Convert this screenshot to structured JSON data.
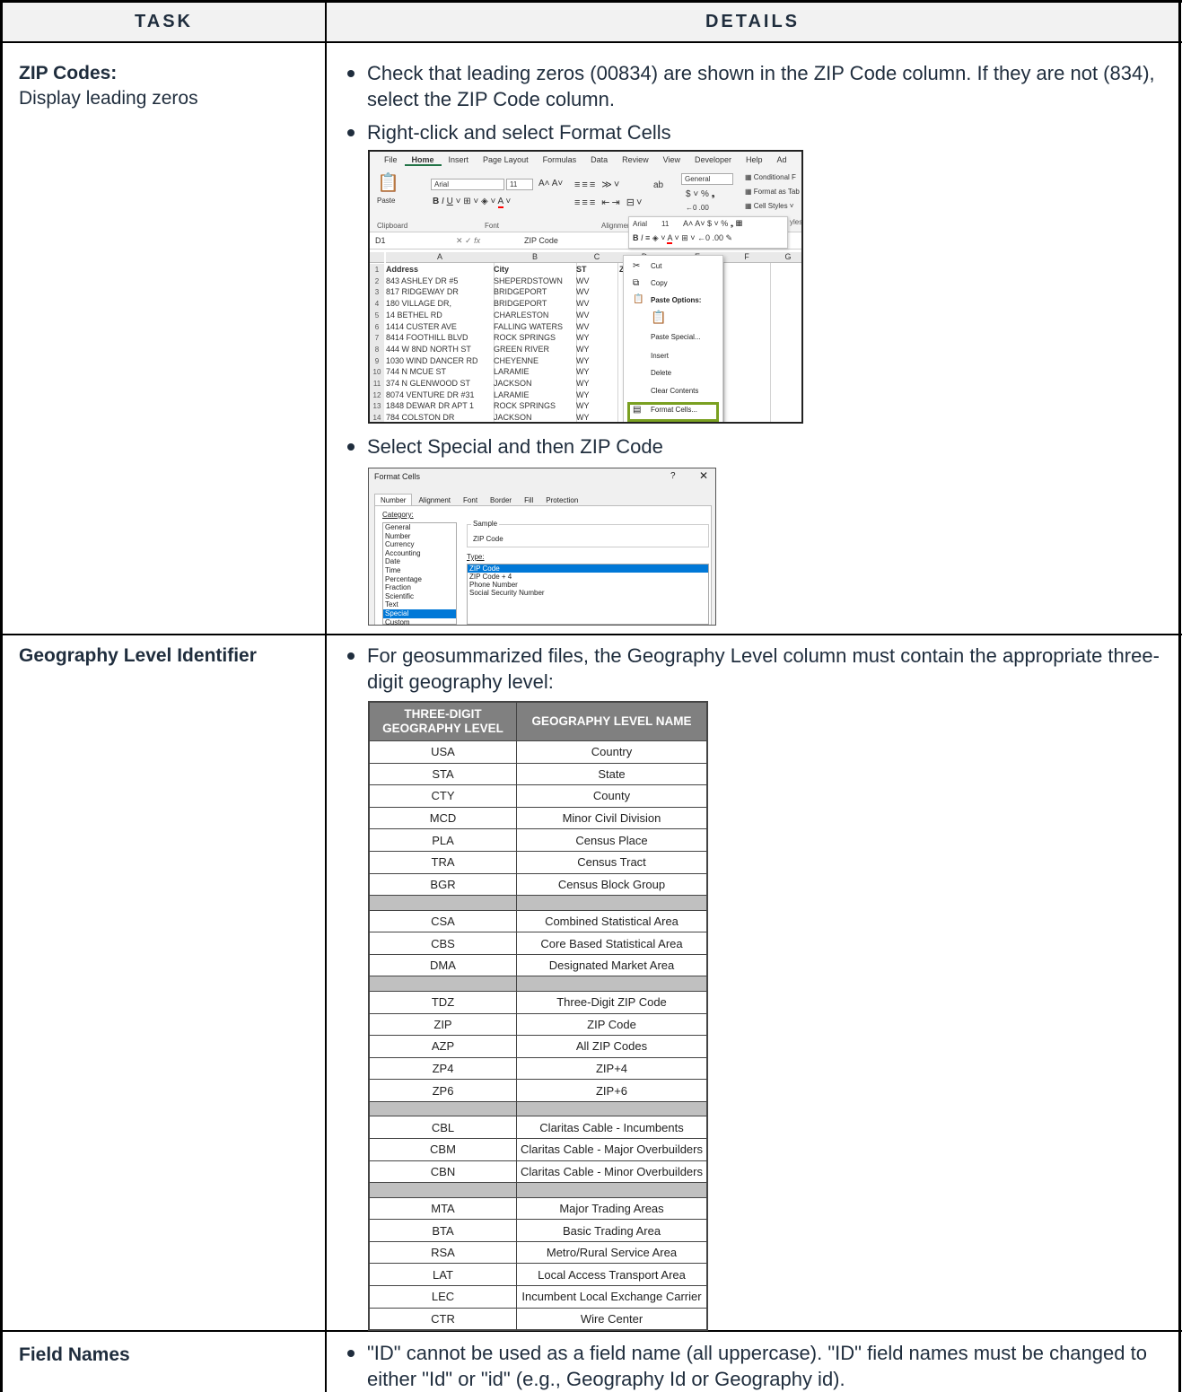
{
  "header": {
    "task": "TASK",
    "details": "DETAILS"
  },
  "section1": {
    "task_title": "ZIP Codes:",
    "task_subtitle": "Display leading zeros",
    "bullet1": "Check that leading zeros (00834) are shown in the ZIP Code column. If they are not (834), select the ZIP Code column.",
    "bullet2": "Right-click and select Format Cells",
    "bullet3": "Select Special and then ZIP Code"
  },
  "excel": {
    "tabs": [
      "File",
      "Home",
      "Insert",
      "Page Layout",
      "Formulas",
      "Data",
      "Review",
      "View",
      "Developer",
      "Help",
      "Ad"
    ],
    "font_name": "Arial",
    "font_size": "11",
    "number_format": "General",
    "styles": [
      "Conditional F",
      "Format as Tab",
      "Cell Styles"
    ],
    "groups": [
      "Clipboard",
      "Font",
      "Alignmen",
      "yles"
    ],
    "paste_label": "Paste",
    "name_box": "D1",
    "formula_value": "ZIP Code",
    "columns": [
      "A",
      "B",
      "C",
      "D",
      "E",
      "F",
      "G"
    ],
    "rows": [
      {
        "n": "1",
        "a": "Address",
        "b": "City",
        "c": "ST",
        "d": "ZI"
      },
      {
        "n": "2",
        "a": "843 ASHLEY DR #5",
        "b": "SHEPERDSTOWN",
        "c": "WV"
      },
      {
        "n": "3",
        "a": "817 RIDGEWAY DR",
        "b": "BRIDGEPORT",
        "c": "WV"
      },
      {
        "n": "4",
        "a": "180 VILLAGE DR,",
        "b": "BRIDGEPORT",
        "c": "WV"
      },
      {
        "n": "5",
        "a": "14 BETHEL RD",
        "b": "CHARLESTON",
        "c": "WV"
      },
      {
        "n": "6",
        "a": "1414 CUSTER AVE",
        "b": "FALLING WATERS",
        "c": "WV"
      },
      {
        "n": "7",
        "a": "8414 FOOTHILL BLVD",
        "b": "ROCK SPRINGS",
        "c": "WY"
      },
      {
        "n": "8",
        "a": "444 W 8ND NORTH ST",
        "b": "GREEN RIVER",
        "c": "WY"
      },
      {
        "n": "9",
        "a": "1030 WIND DANCER RD",
        "b": "CHEYENNE",
        "c": "WY"
      },
      {
        "n": "10",
        "a": "744 N MCUE ST",
        "b": "LARAMIE",
        "c": "WY"
      },
      {
        "n": "11",
        "a": "374 N GLENWOOD ST",
        "b": "JACKSON",
        "c": "WY"
      },
      {
        "n": "12",
        "a": "8074 VENTURE DR #31",
        "b": "LARAMIE",
        "c": "WY"
      },
      {
        "n": "13",
        "a": "1848 DEWAR DR APT 1",
        "b": "ROCK SPRINGS",
        "c": "WY"
      },
      {
        "n": "14",
        "a": "784 COLSTON DR",
        "b": "JACKSON",
        "c": "WY"
      }
    ],
    "menu": {
      "cut": "Cut",
      "copy": "Copy",
      "paste_options": "Paste Options:",
      "paste_special": "Paste Special...",
      "insert": "Insert",
      "delete": "Delete",
      "clear_contents": "Clear Contents",
      "format_cells": "Format Cells..."
    }
  },
  "format_dialog": {
    "title": "Format Cells",
    "help": "?",
    "close": "✕",
    "tabs": [
      "Number",
      "Alignment",
      "Font",
      "Border",
      "Fill",
      "Protection"
    ],
    "category_label": "Category:",
    "categories": [
      "General",
      "Number",
      "Currency",
      "Accounting",
      "Date",
      "Time",
      "Percentage",
      "Fraction",
      "Scientific",
      "Text",
      "Special",
      "Custom"
    ],
    "selected_category": "Special",
    "sample_label": "Sample",
    "sample_value": "ZIP Code",
    "type_label": "Type:",
    "types": [
      "ZIP Code",
      "ZIP Code + 4",
      "Phone Number",
      "Social Security Number"
    ],
    "selected_type": "ZIP Code"
  },
  "section2": {
    "task_title": "Geography Level Identifier",
    "bullet1": "For geosummarized files, the Geography Level column must contain the appropriate three-digit geography level:"
  },
  "geo_table": {
    "col1_line1": "THREE-DIGIT",
    "col1_line2": "GEOGRAPHY LEVEL",
    "col2": "GEOGRAPHY LEVEL NAME",
    "rows": [
      {
        "code": "USA",
        "name": "Country"
      },
      {
        "code": "STA",
        "name": "State"
      },
      {
        "code": "CTY",
        "name": "County"
      },
      {
        "code": "MCD",
        "name": "Minor Civil Division"
      },
      {
        "code": "PLA",
        "name": "Census Place"
      },
      {
        "code": "TRA",
        "name": "Census Tract"
      },
      {
        "code": "BGR",
        "name": "Census Block Group"
      },
      {
        "sep": true
      },
      {
        "code": "CSA",
        "name": "Combined Statistical Area"
      },
      {
        "code": "CBS",
        "name": "Core Based Statistical Area"
      },
      {
        "code": "DMA",
        "name": "Designated Market Area"
      },
      {
        "sep": true
      },
      {
        "code": "TDZ",
        "name": "Three-Digit ZIP Code"
      },
      {
        "code": "ZIP",
        "name": "ZIP Code"
      },
      {
        "code": "AZP",
        "name": "All ZIP Codes"
      },
      {
        "code": "ZP4",
        "name": "ZIP+4"
      },
      {
        "code": "ZP6",
        "name": "ZIP+6"
      },
      {
        "sep": true
      },
      {
        "code": "CBL",
        "name": "Claritas Cable - Incumbents"
      },
      {
        "code": "CBM",
        "name": "Claritas Cable - Major Overbuilders"
      },
      {
        "code": "CBN",
        "name": "Claritas Cable - Minor Overbuilders"
      },
      {
        "sep": true
      },
      {
        "code": "MTA",
        "name": "Major Trading Areas"
      },
      {
        "code": "BTA",
        "name": "Basic Trading Area"
      },
      {
        "code": "RSA",
        "name": "Metro/Rural Service Area"
      },
      {
        "code": "LAT",
        "name": "Local Access Transport Area"
      },
      {
        "code": "LEC",
        "name": "Incumbent Local Exchange Carrier"
      },
      {
        "code": "CTR",
        "name": "Wire Center"
      }
    ]
  },
  "section3": {
    "task_title": "Field Names",
    "bullet1": "\"ID\" cannot be used as a field name (all uppercase). \"ID\" field names must be changed to either \"Id\" or \"id\" (e.g., Geography Id or Geography id)."
  }
}
